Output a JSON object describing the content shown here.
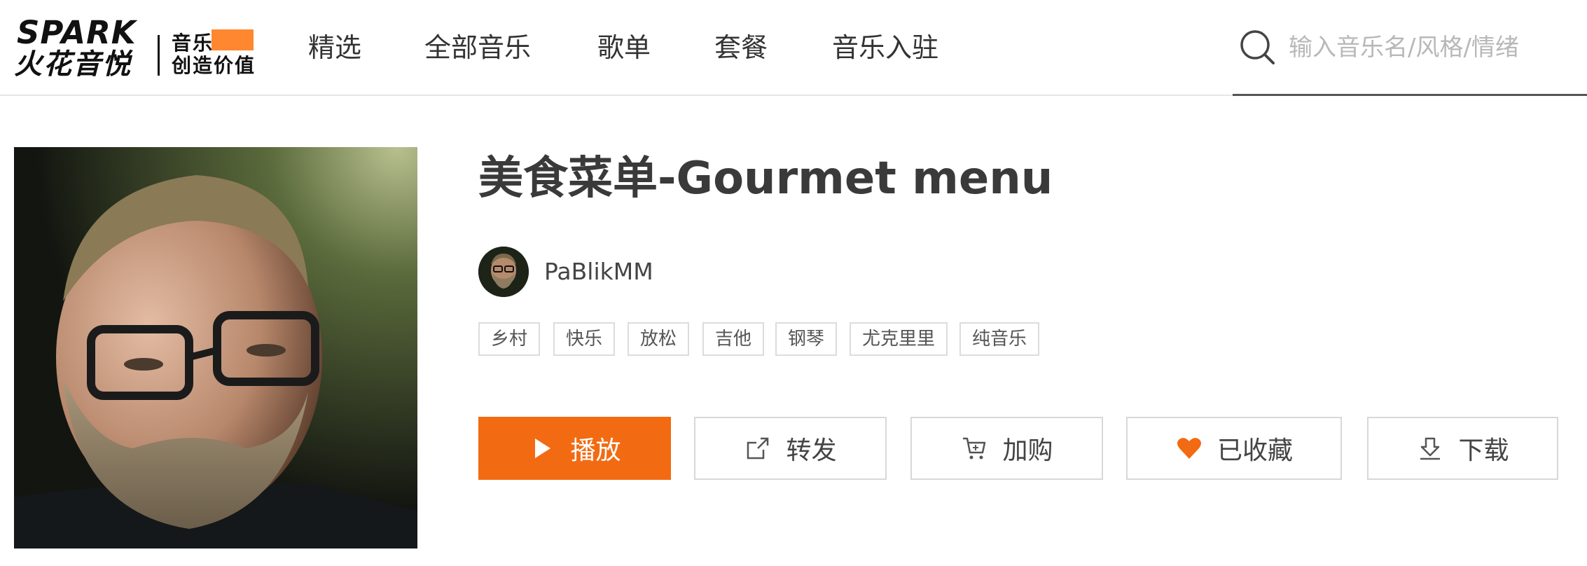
{
  "brand": {
    "name_en": "SPARK",
    "name_cn": "火花音悦",
    "tagline_line1": "音乐",
    "tagline_line2": "创造价值",
    "accent_color": "#f26b12"
  },
  "nav": {
    "items": [
      {
        "label": "精选"
      },
      {
        "label": "全部音乐"
      },
      {
        "label": "歌单"
      },
      {
        "label": "套餐"
      },
      {
        "label": "音乐入驻"
      }
    ]
  },
  "search": {
    "placeholder": "输入音乐名/风格/情绪",
    "value": "",
    "icon": "search-icon"
  },
  "playlist": {
    "title": "美食菜单-Gourmet menu",
    "author": "PaBlikMM",
    "tags": [
      "乡村",
      "快乐",
      "放松",
      "吉他",
      "钢琴",
      "尤克里里",
      "纯音乐"
    ]
  },
  "actions": [
    {
      "label": "播放",
      "icon": "play-icon",
      "primary": true
    },
    {
      "label": "转发",
      "icon": "share-icon"
    },
    {
      "label": "加购",
      "icon": "cart-icon"
    },
    {
      "label": "已收藏",
      "icon": "heart-icon",
      "active_color": "#f26b12"
    },
    {
      "label": "下载",
      "icon": "download-icon"
    }
  ]
}
